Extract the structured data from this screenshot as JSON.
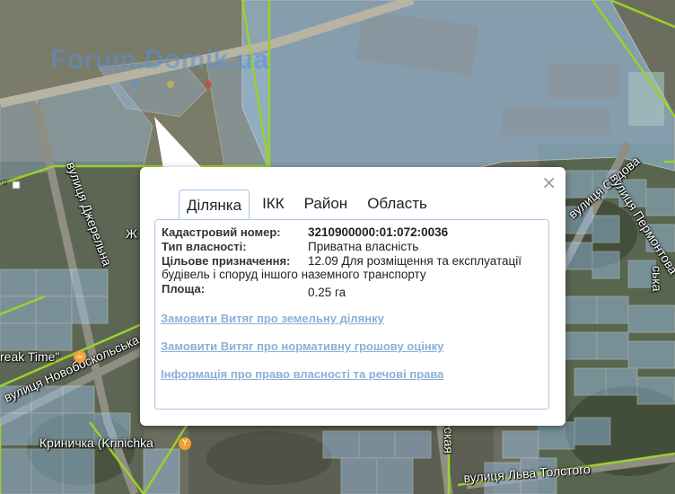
{
  "watermark": "Forum.Domik.ua",
  "map": {
    "streets": [
      "вулиця Джерельна",
      "вулиця Новобоскольська",
      "вулиця Садова",
      "вулиця Пермонтова",
      "вулиця Льва Толстого",
      "Ж",
      "ская",
      "ська"
    ],
    "pois": {
      "break_time": "reak Time\"",
      "krinichka": "Криничка (Krinichka"
    },
    "fragment_quote": "\""
  },
  "popup": {
    "close": "×",
    "tabs": [
      "Ділянка",
      "ІКК",
      "Район",
      "Область"
    ],
    "active_tab": 0,
    "fields": {
      "cadastral_label": "Кадастровий номер:",
      "cadastral_value": "3210900000:01:072:0036",
      "ownership_label": "Тип власності:",
      "ownership_value": "Приватна власність",
      "purpose_label": "Цільове призначення:",
      "purpose_value_line1": "12.09 Для розміщення та експлуатації",
      "purpose_value_line2": "будівель і споруд іншого наземного транспорту",
      "area_label": "Площа:",
      "area_value": "0.25 га"
    },
    "links": [
      "Замовити Витяг про земельну ділянку",
      "Замовити Витяг про нормативну грошову оцінку",
      "Інформація про право власності та речові права"
    ]
  },
  "colors": {
    "parcel_fill": "#9cc4ec",
    "parcel_stroke": "#ffffff",
    "boundary": "#9ad12a",
    "link": "#8ab0d8"
  }
}
